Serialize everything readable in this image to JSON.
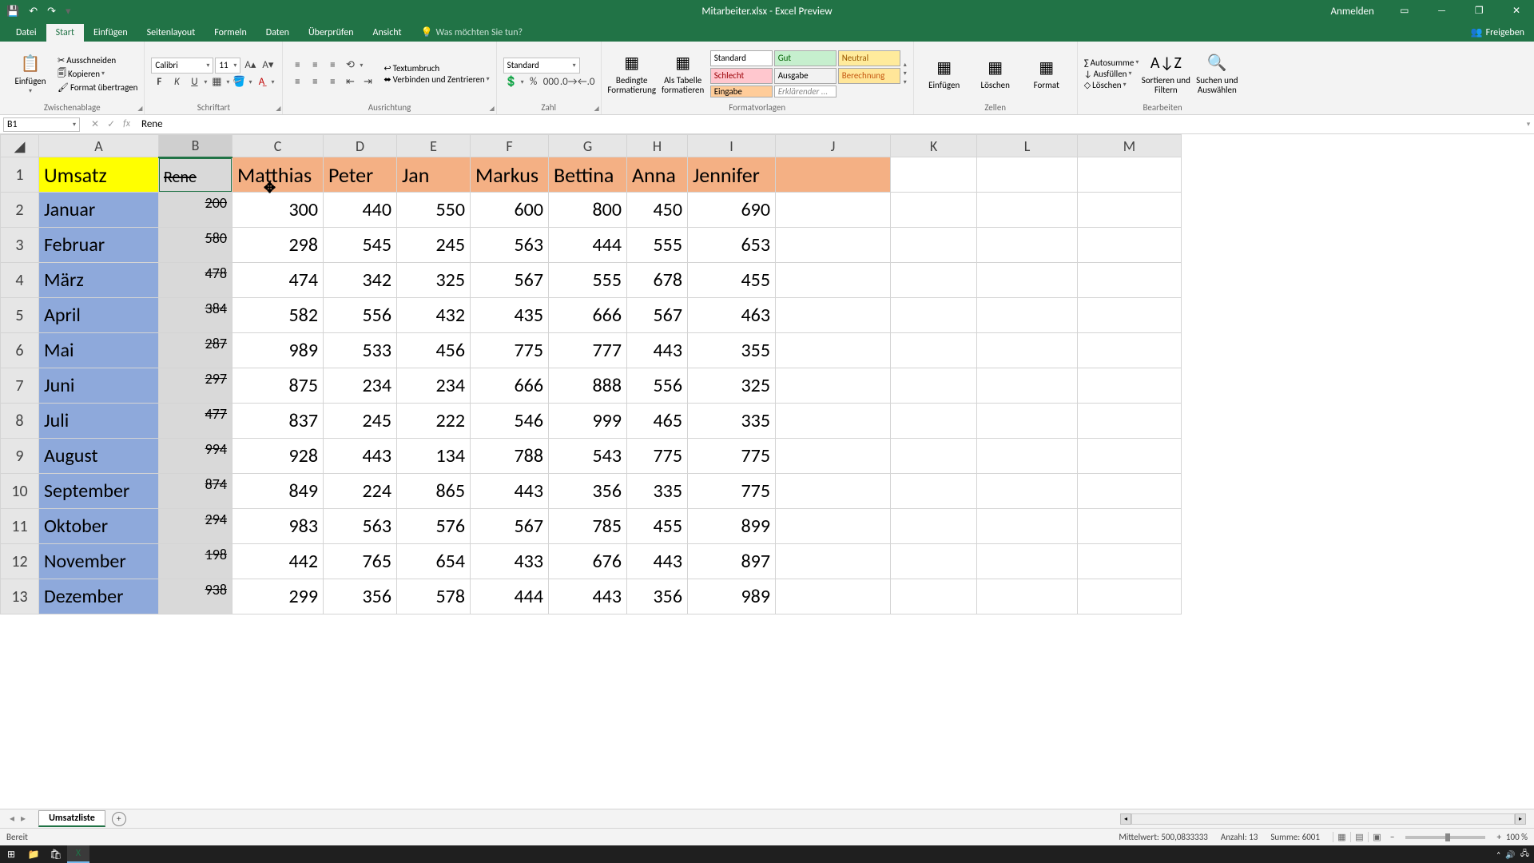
{
  "app": {
    "title": "Mitarbeiter.xlsx - Excel Preview",
    "signin": "Anmelden"
  },
  "tabs": {
    "file": "Datei",
    "start": "Start",
    "insert": "Einfügen",
    "layout": "Seitenlayout",
    "formulas": "Formeln",
    "data": "Daten",
    "review": "Überprüfen",
    "view": "Ansicht",
    "tellme": "Was möchten Sie tun?",
    "share": "Freigeben"
  },
  "ribbon": {
    "clipboard": {
      "paste": "Einfügen",
      "cut": "Ausschneiden",
      "copy": "Kopieren",
      "painter": "Format übertragen",
      "label": "Zwischenablage"
    },
    "font": {
      "name": "Calibri",
      "size": "11",
      "label": "Schriftart"
    },
    "align": {
      "wrap": "Textumbruch",
      "merge": "Verbinden und Zentrieren",
      "label": "Ausrichtung"
    },
    "number": {
      "format": "Standard",
      "label": "Zahl"
    },
    "styles": {
      "cond": "Bedingte\nFormatierung",
      "table": "Als Tabelle\nformatieren",
      "label": "Formatvorlagen",
      "s1": "Standard",
      "s2": "Gut",
      "s3": "Neutral",
      "s4": "Schlecht",
      "s5": "Ausgabe",
      "s6": "Berechnung",
      "s7": "Eingabe",
      "s8": "Erklärender ..."
    },
    "cells": {
      "insert": "Einfügen",
      "delete": "Löschen",
      "format": "Format",
      "label": "Zellen"
    },
    "editing": {
      "sum": "Autosumme",
      "fill": "Ausfüllen",
      "clear": "Löschen",
      "sort": "Sortieren und\nFiltern",
      "find": "Suchen und\nAuswählen",
      "label": "Bearbeiten"
    }
  },
  "nameBox": "B1",
  "formula": "Rene",
  "chart_data": {
    "type": "table",
    "title": "Umsatz",
    "columns": [
      "",
      "Rene",
      "Matthias",
      "Peter",
      "Jan",
      "Markus",
      "Bettina",
      "Anna",
      "Jennifer"
    ],
    "rows": [
      [
        "Januar",
        200,
        300,
        440,
        550,
        600,
        800,
        450,
        690
      ],
      [
        "Februar",
        580,
        298,
        545,
        245,
        563,
        444,
        555,
        653
      ],
      [
        "März",
        478,
        474,
        342,
        325,
        567,
        555,
        678,
        455
      ],
      [
        "April",
        384,
        582,
        556,
        432,
        435,
        666,
        567,
        463
      ],
      [
        "Mai",
        287,
        989,
        533,
        456,
        775,
        777,
        443,
        355
      ],
      [
        "Juni",
        297,
        875,
        234,
        234,
        666,
        888,
        556,
        325
      ],
      [
        "Juli",
        477,
        837,
        245,
        222,
        546,
        999,
        465,
        335
      ],
      [
        "August",
        994,
        928,
        443,
        134,
        788,
        543,
        775,
        775
      ],
      [
        "September",
        874,
        849,
        224,
        865,
        443,
        356,
        335,
        775
      ],
      [
        "Oktober",
        294,
        983,
        563,
        576,
        567,
        785,
        455,
        899
      ],
      [
        "November",
        198,
        442,
        765,
        654,
        433,
        676,
        443,
        897
      ],
      [
        "Dezember",
        938,
        299,
        356,
        578,
        444,
        443,
        356,
        989
      ]
    ]
  },
  "colHeaders": [
    "A",
    "B",
    "C",
    "D",
    "E",
    "F",
    "G",
    "H",
    "I",
    "J",
    "K",
    "L",
    "M"
  ],
  "sheetTab": "Umsatzliste",
  "status": {
    "ready": "Bereit",
    "avg": "Mittelwert: 500,0833333",
    "count": "Anzahl: 13",
    "sum": "Summe: 6001",
    "zoom": "100 %"
  }
}
